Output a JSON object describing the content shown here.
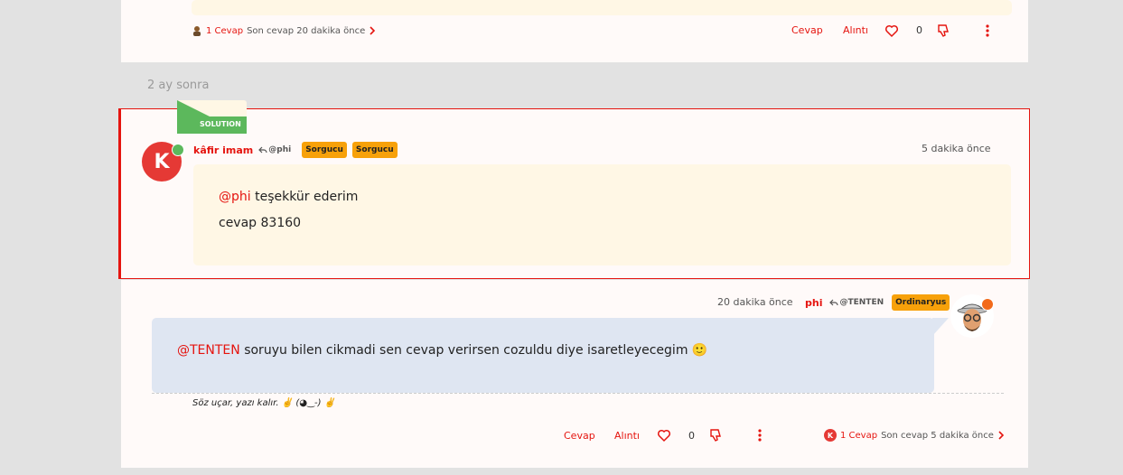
{
  "top_post": {
    "replies": "1 Cevap",
    "last_reply": "Son cevap 20 dakika önce",
    "reply_label": "Cevap",
    "quote_label": "Alıntı",
    "votes": "0"
  },
  "gap_label": "2 ay sonra",
  "solution_label": "SOLUTION",
  "post1": {
    "avatar_letter": "K",
    "author": "kâfir imam",
    "reply_to": "@phi",
    "badges": [
      "Sorgucu",
      "Sorgucu"
    ],
    "time": "5 dakika önce",
    "mention": "@phi",
    "line1_rest": " teşekkür ederim",
    "line2": "cevap 83160"
  },
  "post2": {
    "time": "20 dakika önce",
    "author": "phi",
    "reply_to": "@TENTEN",
    "badge": "Ordinaryus",
    "mention": "@TENTEN",
    "text_rest": " soruyu bilen cikmadi sen cevap verirsen cozuldu diye isaretleyecegim 🙂",
    "signature": "Söz uçar, yazı kalır. ✌️ (◕‿-) ✌️",
    "reply_label": "Cevap",
    "quote_label": "Alıntı",
    "votes": "0",
    "replies_avatar_letter": "K",
    "replies": "1 Cevap",
    "last_reply": "Son cevap 5 dakika önce"
  },
  "colors": {
    "accent": "#e5140f",
    "badge": "#f7a10a",
    "online": "#5cb85c",
    "away": "#f26a1b"
  }
}
